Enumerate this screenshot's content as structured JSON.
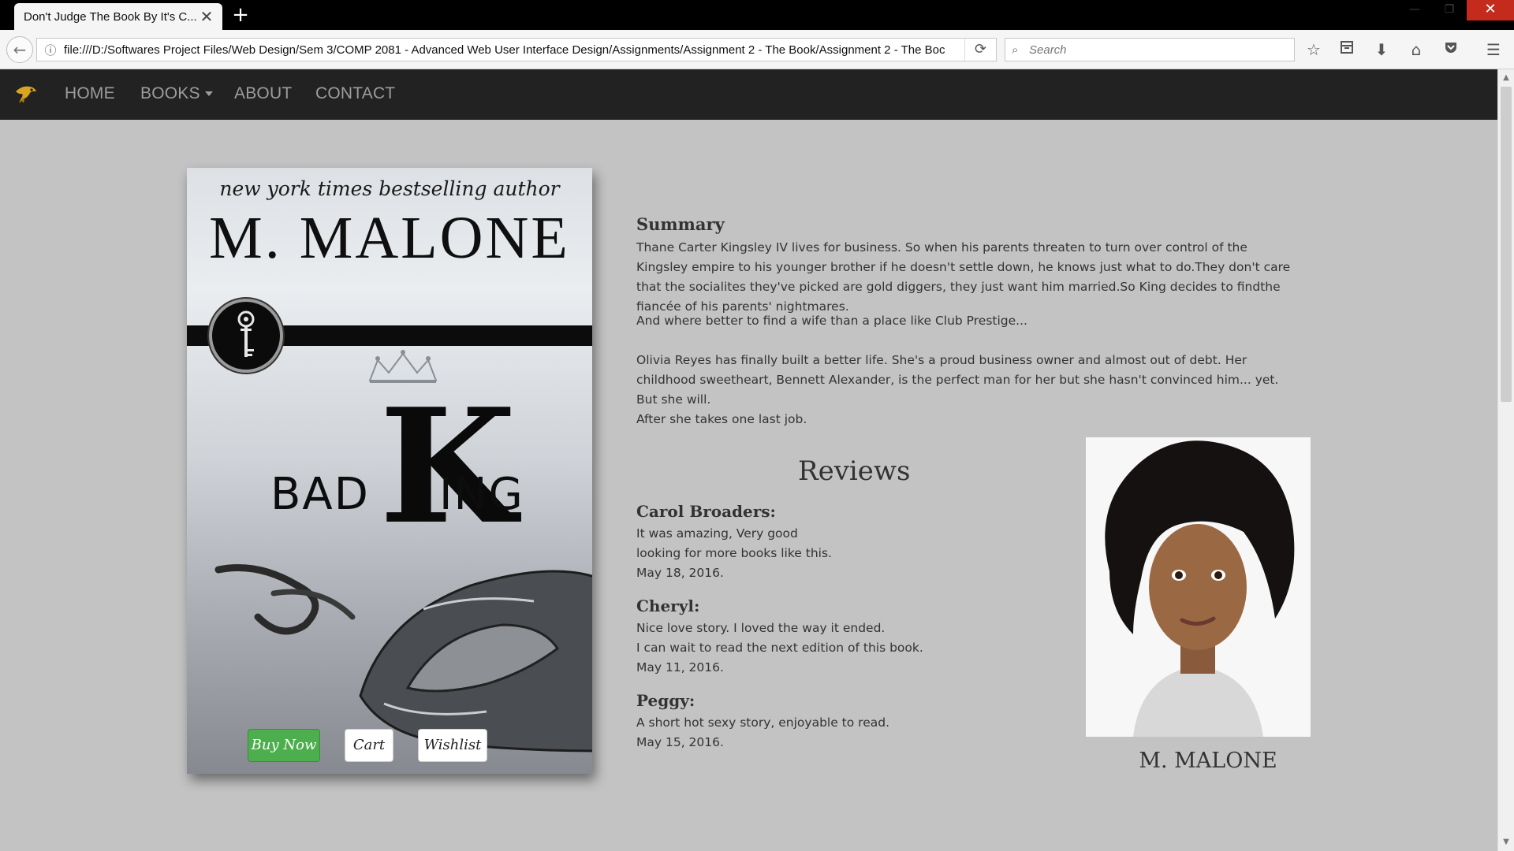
{
  "browser": {
    "tab_title": "Don't Judge The Book By It's C...",
    "tab_close": "✕",
    "new_tab": "+",
    "url": "file:///D:/Softwares Project Files/Web Design/Sem 3/COMP 2081 - Advanced Web User Interface Design/Assignments/Assignment 2 - The Book/Assignment 2 - The Boc",
    "search_placeholder": "Search"
  },
  "nav": {
    "items": [
      "HOME",
      "BOOKS",
      "ABOUT",
      "CONTACT"
    ]
  },
  "cover": {
    "tagline": "new york times bestselling author",
    "author": "M. MALONE",
    "title_left": "BAD",
    "title_k": "K",
    "title_right": "ING",
    "buttons": {
      "buy": "Buy Now",
      "cart": "Cart",
      "wishlist": "Wishlist"
    },
    "colors": {
      "buy": "#4cae4c"
    }
  },
  "summary": {
    "heading": "Summary",
    "paragraphs": [
      "Thane Carter Kingsley IV lives for business. So when his parents threaten to turn over control of the Kingsley empire to his younger brother if he doesn't settle down, he knows just what to do.They don't care that the socialites they've picked are gold diggers, they just want him married.So King decides to findthe fiancée of his parents' nightmares.",
      "And where better to find a wife than a place like Club Prestige...",
      "Olivia Reyes has finally built a better life. She's a proud business owner and almost out of debt. Her childhood sweetheart, Bennett Alexander, is the perfect man for her but she hasn't convinced him... yet. But she will.",
      "After she takes one last job."
    ]
  },
  "reviews": {
    "heading": "Reviews",
    "items": [
      {
        "name": "Carol Broaders:",
        "lines": [
          "It was amazing, Very good",
          "looking for more books like this."
        ],
        "date": "May 18, 2016."
      },
      {
        "name": "Cheryl:",
        "lines": [
          "Nice love story. I loved the way it ended.",
          "I can wait to read the next edition of this book."
        ],
        "date": "May 11, 2016."
      },
      {
        "name": "Peggy:",
        "lines": [
          "A short hot sexy story, enjoyable to read."
        ],
        "date": "May 15, 2016."
      }
    ]
  },
  "author": {
    "caption": "M. MALONE"
  }
}
